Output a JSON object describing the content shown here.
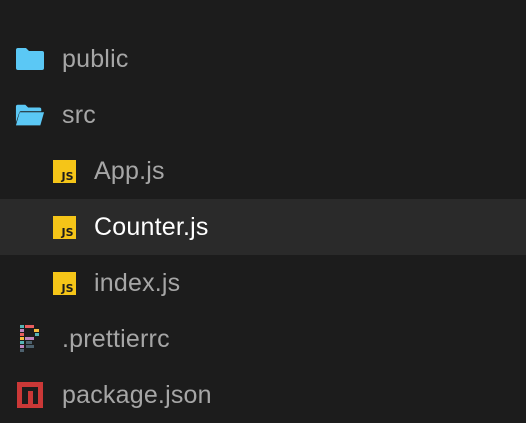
{
  "explorer": {
    "items": [
      {
        "label": "public",
        "icon": "folder-icon",
        "depth": 0
      },
      {
        "label": "src",
        "icon": "folder-open-icon",
        "depth": 0
      },
      {
        "label": "App.js",
        "icon": "js-file-icon",
        "depth": 1
      },
      {
        "label": "Counter.js",
        "icon": "js-file-icon",
        "depth": 1,
        "selected": true
      },
      {
        "label": "index.js",
        "icon": "js-file-icon",
        "depth": 1
      },
      {
        "label": ".prettierrc",
        "icon": "prettier-icon",
        "depth": 0
      },
      {
        "label": "package.json",
        "icon": "npm-icon",
        "depth": 0
      }
    ],
    "js_badge_text": "JS"
  },
  "colors": {
    "background": "#1c1c1c",
    "selected_row": "#2a2a2a",
    "label": "#a6a6a6",
    "selected_label": "#ffffff",
    "folder": "#5bc8f5",
    "js_badge": "#f5c518",
    "npm": "#cb3837"
  }
}
